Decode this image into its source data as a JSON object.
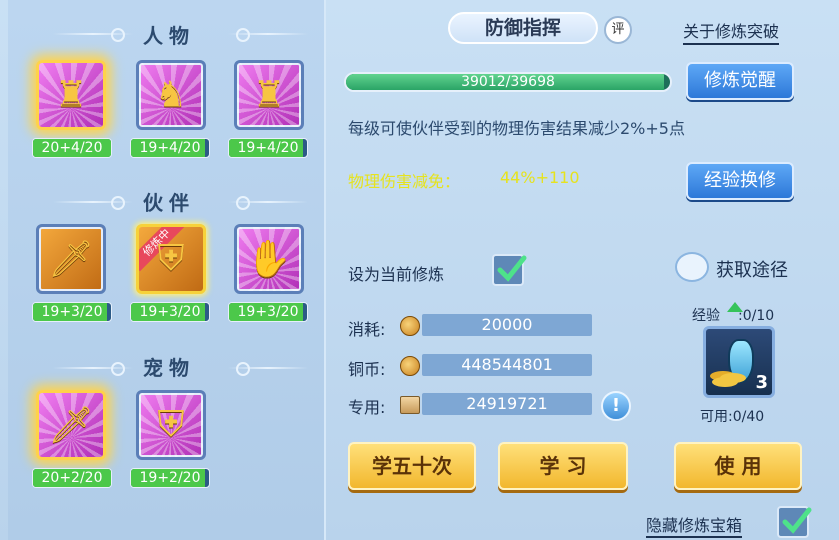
{
  "left": {
    "sections": [
      {
        "title": "人物",
        "slots": [
          {
            "icon": "armored-warrior-meditating-icon",
            "level": "20+4/20",
            "fill": 1.0,
            "style": "glow"
          },
          {
            "icon": "armored-warrior-shield-icon",
            "level": "19+4/20",
            "fill": 0.95,
            "style": "normal"
          },
          {
            "icon": "armored-warrior-icon",
            "level": "19+4/20",
            "fill": 0.95,
            "style": "normal"
          }
        ]
      },
      {
        "title": "伙伴",
        "slots": [
          {
            "icon": "lion-sword-icon",
            "level": "19+3/20",
            "fill": 0.95,
            "style": "gold"
          },
          {
            "icon": "lion-shield-icon",
            "level": "19+3/20",
            "fill": 0.95,
            "style": "selected",
            "ribbon": "修炼中"
          },
          {
            "icon": "lion-gauntlet-icon",
            "level": "19+3/20",
            "fill": 0.95,
            "style": "normal"
          }
        ]
      },
      {
        "title": "宠物",
        "slots": [
          {
            "icon": "cat-sword-icon",
            "level": "20+2/20",
            "fill": 1.0,
            "style": "glow"
          },
          {
            "icon": "cat-shield-icon",
            "level": "19+2/20",
            "fill": 0.95,
            "style": "normal"
          }
        ]
      }
    ]
  },
  "header": {
    "tab_title": "防御指挥",
    "eval_badge": "评",
    "about_link": "关于修炼突破"
  },
  "exp_bar": {
    "text": "39012/39698",
    "current": 39012,
    "max": 39698
  },
  "buttons": {
    "awaken": "修炼觉醒",
    "exchange": "经验换修",
    "learn_50": "学五十次",
    "learn": "学 习",
    "use": "使 用"
  },
  "description": "每级可使伙伴受到的物理伤害结果减少2%+5点",
  "effect": {
    "label": "物理伤害减免：",
    "value": "44%+110"
  },
  "set_current": {
    "label": "设为当前修炼",
    "checked": true
  },
  "guide": {
    "label": "获取途径"
  },
  "costs": [
    {
      "label": "消耗:",
      "icon": "coin-icon",
      "value": "20000"
    },
    {
      "label": "铜币:",
      "icon": "coin-icon",
      "value": "448544801"
    },
    {
      "label": "专用:",
      "icon": "scroll-icon",
      "value": "24919721"
    }
  ],
  "info_icon": "!",
  "exp_item": {
    "label": "经验",
    "progress": ":0/10",
    "count": "3",
    "available": "可用:0/40"
  },
  "hide_toggle": {
    "label": "隐藏修炼宝箱",
    "checked": true
  },
  "colors": {
    "accent_yellow": "#e6e31e",
    "bar_green": "#4cc84a",
    "text_dark": "#1c3150"
  }
}
